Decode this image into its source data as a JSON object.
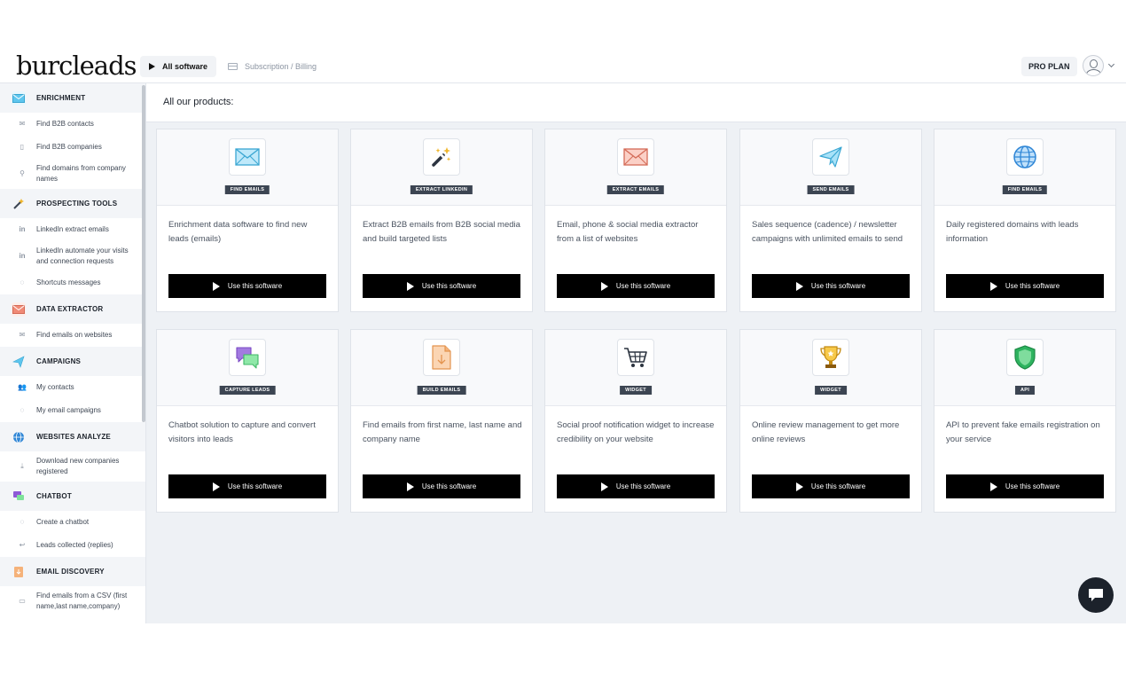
{
  "header": {
    "logo": "burcleads",
    "nav_active": "All software",
    "nav_link": "Subscription / Billing",
    "plan": "PRO PLAN"
  },
  "sidebar": {
    "sections": [
      {
        "title": "ENRICHMENT",
        "icon": "envelope-icon",
        "items": [
          {
            "label": "Find B2B contacts",
            "icon": "mail-icon"
          },
          {
            "label": "Find B2B companies",
            "icon": "building-icon"
          },
          {
            "label": "Find domains from company names",
            "icon": "search-icon"
          }
        ]
      },
      {
        "title": "PROSPECTING TOOLS",
        "icon": "magic-wand-icon",
        "items": [
          {
            "label": "LinkedIn extract emails",
            "icon": "linkedin-icon"
          },
          {
            "label": "LinkedIn automate your visits and connection requests",
            "icon": "linkedin-icon"
          },
          {
            "label": "Shortcuts messages",
            "icon": "comment-icon"
          }
        ]
      },
      {
        "title": "DATA EXTRACTOR",
        "icon": "envelope-icon",
        "items": [
          {
            "label": "Find emails on websites",
            "icon": "mail-icon"
          }
        ]
      },
      {
        "title": "CAMPAIGNS",
        "icon": "paper-plane-icon",
        "items": [
          {
            "label": "My contacts",
            "icon": "users-icon"
          },
          {
            "label": "My email campaigns",
            "icon": "comments-icon"
          }
        ]
      },
      {
        "title": "WEBSITES ANALYZE",
        "icon": "globe-icon",
        "items": [
          {
            "label": "Download new companies registered",
            "icon": "download-icon"
          }
        ]
      },
      {
        "title": "CHATBOT",
        "icon": "chat-bubbles-icon",
        "items": [
          {
            "label": "Create a chatbot",
            "icon": "comment-icon"
          },
          {
            "label": "Leads collected (replies)",
            "icon": "reply-icon"
          }
        ]
      },
      {
        "title": "EMAIL DISCOVERY",
        "icon": "document-icon",
        "items": [
          {
            "label": "Find emails from a CSV (first name,last name,company)",
            "icon": "file-icon"
          }
        ]
      }
    ]
  },
  "main": {
    "title": "All our products:",
    "button_label": "Use this software",
    "products": [
      {
        "badge": "FIND EMAILS",
        "icon": "envelope-icon",
        "desc": "Enrichment data software to find new leads (emails)"
      },
      {
        "badge": "EXTRACT LINKEDIN",
        "icon": "magic-wand-icon",
        "desc": "Extract B2B emails from B2B social media and build targeted lists"
      },
      {
        "badge": "EXTRACT EMAILS",
        "icon": "envelope-icon",
        "desc": "Email, phone & social media extractor from a list of websites"
      },
      {
        "badge": "SEND EMAILS",
        "icon": "paper-plane-icon",
        "desc": "Sales sequence (cadence) / newsletter campaigns with unlimited emails to send"
      },
      {
        "badge": "FIND EMAILS",
        "icon": "globe-icon",
        "desc": "Daily registered domains with leads information"
      },
      {
        "badge": "CAPTURE LEADS",
        "icon": "chat-bubbles-icon",
        "desc": "Chatbot solution to capture and convert visitors into leads"
      },
      {
        "badge": "BUILD EMAILS",
        "icon": "document-download-icon",
        "desc": "Find emails from first name, last name and company name"
      },
      {
        "badge": "WIDGET",
        "icon": "shopping-cart-icon",
        "desc": "Social proof notification widget to increase credibility on your website"
      },
      {
        "badge": "WIDGET",
        "icon": "trophy-icon",
        "desc": "Online review management to get more online reviews"
      },
      {
        "badge": "API",
        "icon": "shield-icon",
        "desc": "API to prevent fake emails registration on your service"
      }
    ]
  },
  "colors": {
    "envelope_blue": "#5ec6ee",
    "envelope_red": "#f08a76",
    "plane_blue": "#5ec6ee",
    "globe_blue": "#2f86d6",
    "chat_purple": "#8e5ad6",
    "chat_green": "#7ee29a",
    "doc_orange": "#f5b27a",
    "shield_green": "#2eb35f",
    "trophy_gold": "#f0b62c"
  }
}
